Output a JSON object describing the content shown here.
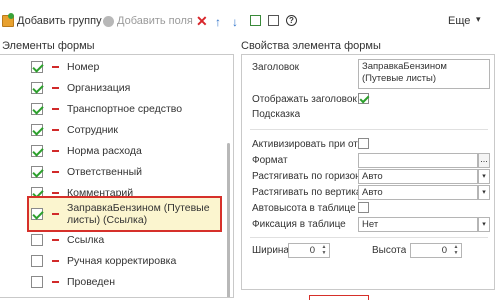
{
  "toolbar": {
    "add_group": "Добавить группу",
    "add_field": "Добавить поля",
    "more": "Еще",
    "more_chevron": "▾",
    "delete_glyph": "✕",
    "up_glyph": "↑",
    "down_glyph": "↓",
    "help_glyph": "?"
  },
  "left_title": "Элементы формы",
  "right_title": "Свойства элемента формы",
  "elements": [
    {
      "label": "Номер",
      "checked": true
    },
    {
      "label": "Организация",
      "checked": true
    },
    {
      "label": "Транспортное средство",
      "checked": true
    },
    {
      "label": "Сотрудник",
      "checked": true
    },
    {
      "label": "Норма расхода",
      "checked": true
    },
    {
      "label": "Ответственный",
      "checked": true
    },
    {
      "label": "Комментарий",
      "checked": true
    },
    {
      "label": "ЗаправкаБензином (Путевые листы) (Ссылка)",
      "checked": true,
      "selected": true
    },
    {
      "label": "Ссылка",
      "checked": false
    },
    {
      "label": "Ручная корректировка",
      "checked": false
    },
    {
      "label": "Проведен",
      "checked": false
    }
  ],
  "properties": {
    "title_label": "Заголовок",
    "title_value": "ЗаправкаБензином (Путевые листы)",
    "show_title_label": "Отображать заголовок",
    "show_title_checked": true,
    "hint_label": "Подсказка",
    "activate_label": "Активизировать при открытии",
    "activate_checked": false,
    "format_label": "Формат",
    "format_value": "",
    "ellipsis": "...",
    "stretch_h_label": "Растягивать по горизонтали",
    "stretch_h_value": "Авто",
    "stretch_v_label": "Растягивать по вертикали",
    "stretch_v_value": "Авто",
    "autoheight_label": "Автовысота в таблице",
    "autoheight_checked": false,
    "fix_label": "Фиксация в таблице",
    "fix_value": "Нет",
    "width_label": "Ширина",
    "width_value": "0",
    "height_label": "Высота",
    "height_value": "0",
    "dropdown_glyph": "▾"
  }
}
